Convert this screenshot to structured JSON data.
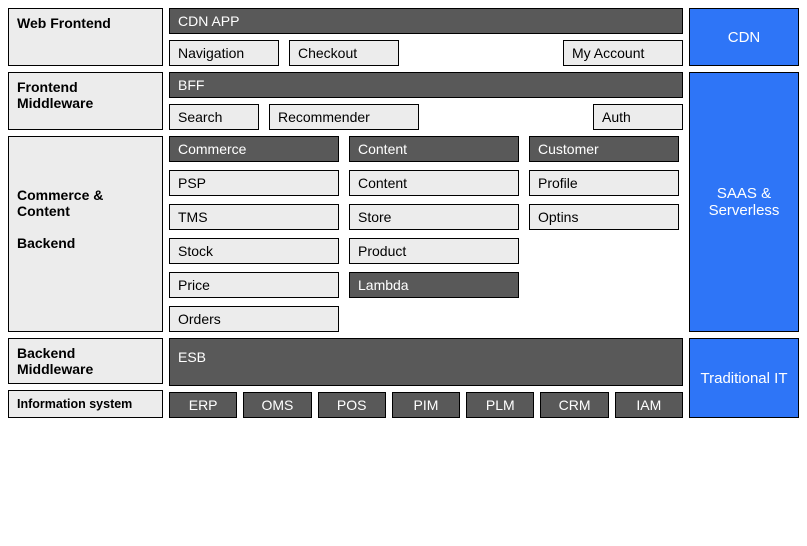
{
  "rows": {
    "web_frontend": {
      "label": "Web Frontend",
      "header": "CDN APP",
      "items": {
        "nav": "Navigation",
        "checkout": "Checkout",
        "myacc": "My Account"
      }
    },
    "frontend_mw": {
      "label": "Frontend Middleware",
      "header": "BFF",
      "items": {
        "search": "Search",
        "rec": "Recommender",
        "auth": "Auth"
      }
    },
    "backend": {
      "label": "Commerce & Content\n\nBackend",
      "commerce": {
        "header": "Commerce",
        "items": [
          "PSP",
          "TMS",
          "Stock",
          "Price",
          "Orders"
        ]
      },
      "content": {
        "header": "Content",
        "items": [
          "Content",
          "Store",
          "Product"
        ],
        "lambda": "Lambda"
      },
      "customer": {
        "header": "Customer",
        "items": [
          "Profile",
          "Optins"
        ]
      }
    },
    "backend_mw": {
      "label": "Backend Middleware",
      "header": "ESB"
    },
    "info_sys": {
      "label": "Information system",
      "items": [
        "ERP",
        "OMS",
        "POS",
        "PIM",
        "PLM",
        "CRM",
        "IAM"
      ]
    }
  },
  "right": {
    "cdn": "CDN",
    "saas": "SAAS & Serverless",
    "trad": "Traditional IT"
  }
}
